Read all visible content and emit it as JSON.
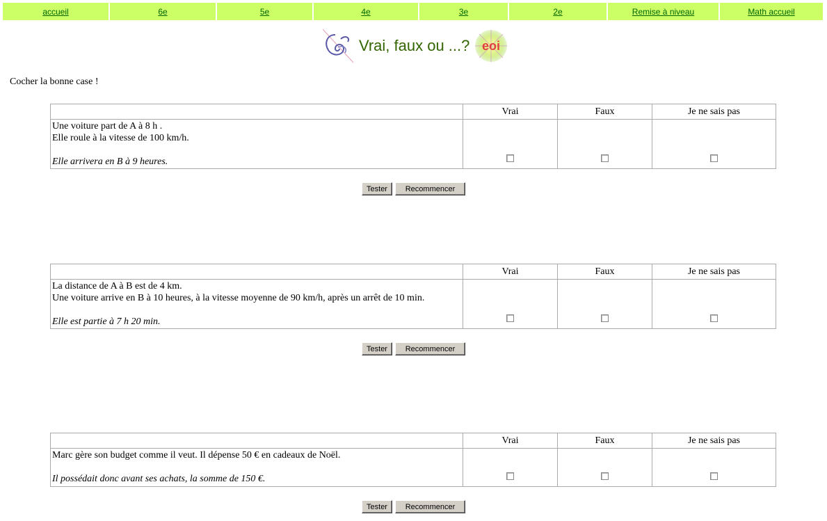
{
  "nav": [
    {
      "label": "accueil",
      "w": 152
    },
    {
      "label": "6e",
      "w": 152
    },
    {
      "label": "5e",
      "w": 137
    },
    {
      "label": "4e",
      "w": 150
    },
    {
      "label": "3e",
      "w": 127
    },
    {
      "label": "2e",
      "w": 140
    },
    {
      "label": "Remise à niveau",
      "w": 159
    },
    {
      "label": "Math accueil",
      "w": 148
    }
  ],
  "title": "Vrai, faux ou ...?",
  "logo_text": "eoi",
  "instruction": "Cocher la bonne case !",
  "headers": {
    "col1": "Vrai",
    "col2": "Faux",
    "col3": "Je ne sais pas"
  },
  "buttons": {
    "test": "Tester",
    "reset": "Recommencer"
  },
  "questions": [
    {
      "lines": [
        "Une voiture part de A à 8 h .",
        "Elle roule à la vitesse de 100 km/h."
      ],
      "assertion": "Elle arrivera en B à 9 heures."
    },
    {
      "lines": [
        "La distance de A à B est de 4 km.",
        "Une voiture arrive en B à 10 heures, à la vitesse moyenne de 90 km/h, après un arrêt de 10 min."
      ],
      "assertion": "Elle est partie à 7 h 20 min."
    },
    {
      "lines": [
        "Marc gère son budget comme il veut. Il dépense 50 € en cadeaux de Noël."
      ],
      "assertion": "Il possédait donc avant ses achats, la somme de 150 €."
    }
  ]
}
